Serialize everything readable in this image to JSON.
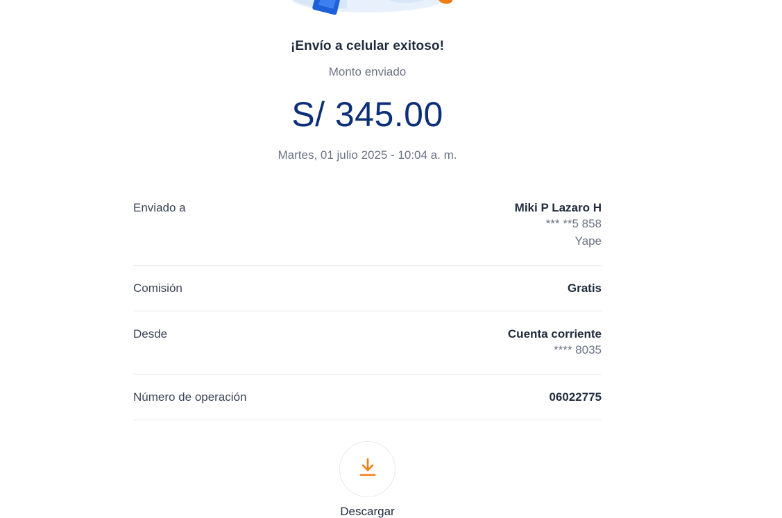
{
  "receipt": {
    "title": "¡Envío a celular exitoso!",
    "subtitle": "Monto enviado",
    "amount": "S/ 345.00",
    "datetime": "Martes, 01 julio 2025 - 10:04 a. m."
  },
  "details": {
    "sent_to": {
      "label": "Enviado a",
      "name": "Miki P Lazaro H",
      "phone": "*** **5 858",
      "app": "Yape"
    },
    "commission": {
      "label": "Comisión",
      "value": "Gratis"
    },
    "from": {
      "label": "Desde",
      "account": "Cuenta corriente",
      "number": "**** 8035"
    },
    "operation": {
      "label": "Número de operación",
      "value": "06022775"
    }
  },
  "actions": {
    "download_label": "Descargar",
    "download_icon": "download-icon"
  },
  "colors": {
    "amount": "#0c2f7a",
    "accent_orange": "#f07d14",
    "illustration_blue": "#1d5fd6"
  }
}
